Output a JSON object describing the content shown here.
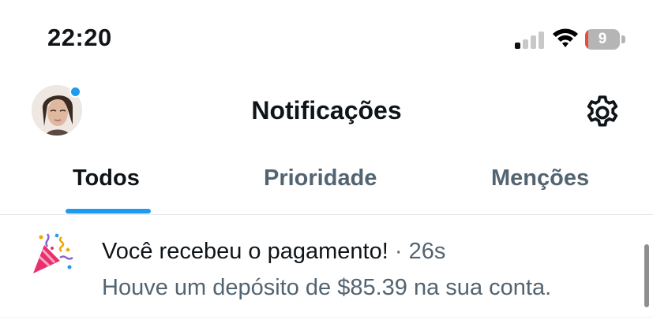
{
  "status_bar": {
    "time": "22:20",
    "battery_percent": "9",
    "battery_level": 0.09,
    "signal_bars_active": 1,
    "icons": [
      "signal-icon",
      "wifi-icon",
      "battery-icon"
    ]
  },
  "header": {
    "title": "Notificações",
    "avatar_icon": "avatar",
    "settings_icon": "gear-icon",
    "avatar_badge_color": "#1d9bf0"
  },
  "tabs": [
    {
      "label": "Todos",
      "active": true
    },
    {
      "label": "Prioridade",
      "active": false
    },
    {
      "label": "Menções",
      "active": false
    }
  ],
  "notifications": [
    {
      "icon": "party-popper-icon",
      "title": "Você recebeu o pagamento!",
      "separator": "·",
      "time": "26s",
      "body": "Houve um depósito de $85.39 na sua conta."
    }
  ],
  "colors": {
    "accent": "#1d9bf0",
    "text_primary": "#0f1419",
    "text_secondary": "#536471",
    "battery_low": "#eb4d3d"
  }
}
